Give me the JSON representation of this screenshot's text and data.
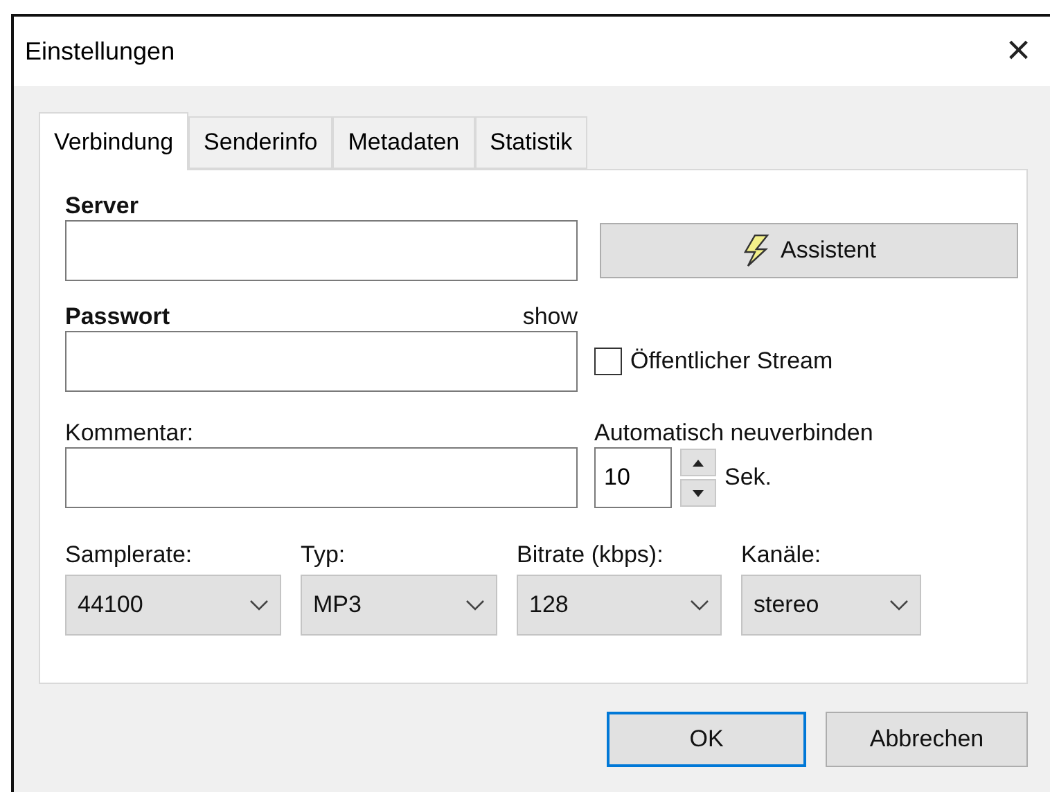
{
  "window": {
    "title": "Einstellungen",
    "close": "×"
  },
  "tabs": [
    {
      "label": "Verbindung",
      "selected": true
    },
    {
      "label": "Senderinfo",
      "selected": false
    },
    {
      "label": "Metadaten",
      "selected": false
    },
    {
      "label": "Statistik",
      "selected": false
    }
  ],
  "server": {
    "label": "Server",
    "assistant_button": "Assistent"
  },
  "password": {
    "label": "Passwort",
    "show_link": "show"
  },
  "public_stream": {
    "label": "Öffentlicher Stream",
    "checked": false
  },
  "comment": {
    "label": "Kommentar:"
  },
  "reconnect": {
    "label": "Automatisch neuverbinden",
    "value": "10",
    "unit": "Sek."
  },
  "dropdowns": [
    {
      "label": "Samplerate:",
      "value": "44100"
    },
    {
      "label": "Typ:",
      "value": "MP3"
    },
    {
      "label": "Bitrate (kbps):",
      "value": "128"
    },
    {
      "label": "Kanäle:",
      "value": "stereo"
    }
  ],
  "buttons": [
    {
      "label": "OK",
      "default": true
    },
    {
      "label": "Abbrechen",
      "default": false
    }
  ]
}
